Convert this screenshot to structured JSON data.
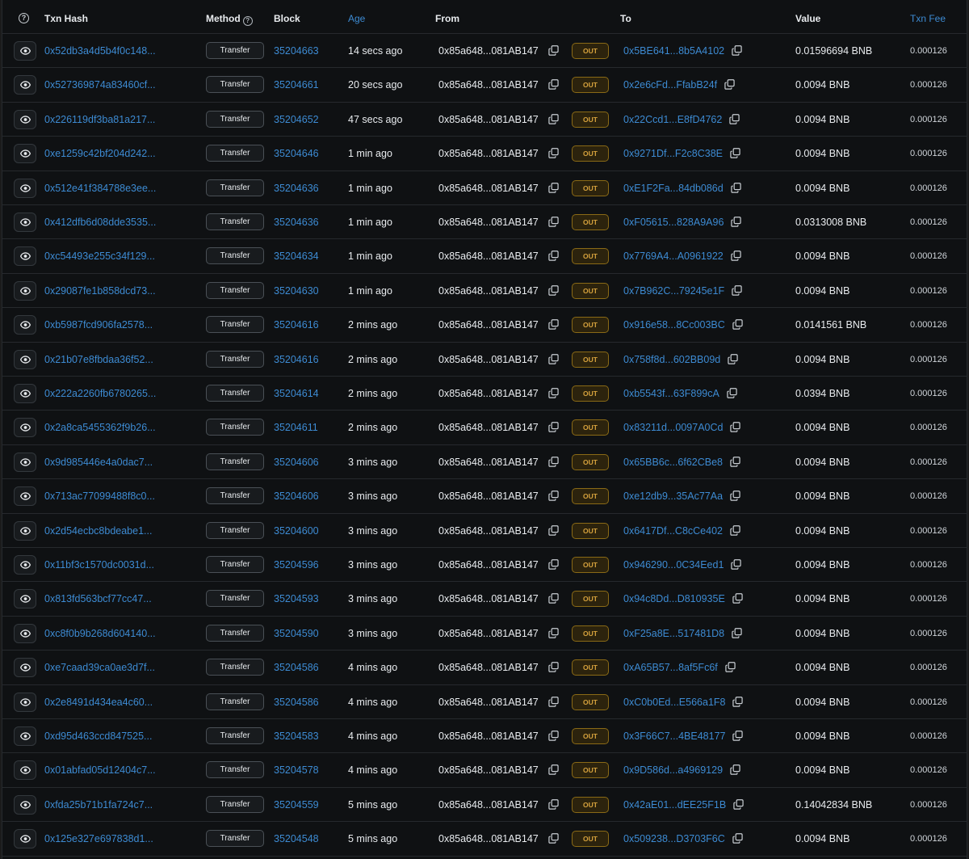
{
  "header": {
    "txn_hash": "Txn Hash",
    "method": "Method",
    "block": "Block",
    "age": "Age",
    "from": "From",
    "to": "To",
    "value": "Value",
    "txn_fee": "Txn Fee",
    "help_glyph": "?"
  },
  "method_label": "Transfer",
  "direction_label": "OUT",
  "rows": [
    {
      "hash": "0x52db3a4d5b4f0c148...",
      "block": "35204663",
      "age": "14 secs ago",
      "from": "0x85a648...081AB147",
      "to": "0x5BE641...8b5A4102",
      "value": "0.01596694 BNB",
      "fee": "0.000126"
    },
    {
      "hash": "0x527369874a83460cf...",
      "block": "35204661",
      "age": "20 secs ago",
      "from": "0x85a648...081AB147",
      "to": "0x2e6cFd...FfabB24f",
      "value": "0.0094 BNB",
      "fee": "0.000126"
    },
    {
      "hash": "0x226119df3ba81a217...",
      "block": "35204652",
      "age": "47 secs ago",
      "from": "0x85a648...081AB147",
      "to": "0x22Ccd1...E8fD4762",
      "value": "0.0094 BNB",
      "fee": "0.000126"
    },
    {
      "hash": "0xe1259c42bf204d242...",
      "block": "35204646",
      "age": "1 min ago",
      "from": "0x85a648...081AB147",
      "to": "0x9271Df...F2c8C38E",
      "value": "0.0094 BNB",
      "fee": "0.000126"
    },
    {
      "hash": "0x512e41f384788e3ee...",
      "block": "35204636",
      "age": "1 min ago",
      "from": "0x85a648...081AB147",
      "to": "0xE1F2Fa...84db086d",
      "value": "0.0094 BNB",
      "fee": "0.000126"
    },
    {
      "hash": "0x412dfb6d08dde3535...",
      "block": "35204636",
      "age": "1 min ago",
      "from": "0x85a648...081AB147",
      "to": "0xF05615...828A9A96",
      "value": "0.0313008 BNB",
      "fee": "0.000126"
    },
    {
      "hash": "0xc54493e255c34f129...",
      "block": "35204634",
      "age": "1 min ago",
      "from": "0x85a648...081AB147",
      "to": "0x7769A4...A0961922",
      "value": "0.0094 BNB",
      "fee": "0.000126"
    },
    {
      "hash": "0x29087fe1b858dcd73...",
      "block": "35204630",
      "age": "1 min ago",
      "from": "0x85a648...081AB147",
      "to": "0x7B962C...79245e1F",
      "value": "0.0094 BNB",
      "fee": "0.000126"
    },
    {
      "hash": "0xb5987fcd906fa2578...",
      "block": "35204616",
      "age": "2 mins ago",
      "from": "0x85a648...081AB147",
      "to": "0x916e58...8Cc003BC",
      "value": "0.0141561 BNB",
      "fee": "0.000126"
    },
    {
      "hash": "0x21b07e8fbdaa36f52...",
      "block": "35204616",
      "age": "2 mins ago",
      "from": "0x85a648...081AB147",
      "to": "0x758f8d...602BB09d",
      "value": "0.0094 BNB",
      "fee": "0.000126"
    },
    {
      "hash": "0x222a2260fb6780265...",
      "block": "35204614",
      "age": "2 mins ago",
      "from": "0x85a648...081AB147",
      "to": "0xb5543f...63F899cA",
      "value": "0.0394 BNB",
      "fee": "0.000126"
    },
    {
      "hash": "0x2a8ca5455362f9b26...",
      "block": "35204611",
      "age": "2 mins ago",
      "from": "0x85a648...081AB147",
      "to": "0x83211d...0097A0Cd",
      "value": "0.0094 BNB",
      "fee": "0.000126"
    },
    {
      "hash": "0x9d985446e4a0dac7...",
      "block": "35204606",
      "age": "3 mins ago",
      "from": "0x85a648...081AB147",
      "to": "0x65BB6c...6f62CBe8",
      "value": "0.0094 BNB",
      "fee": "0.000126"
    },
    {
      "hash": "0x713ac77099488f8c0...",
      "block": "35204606",
      "age": "3 mins ago",
      "from": "0x85a648...081AB147",
      "to": "0xe12db9...35Ac77Aa",
      "value": "0.0094 BNB",
      "fee": "0.000126"
    },
    {
      "hash": "0x2d54ecbc8bdeabe1...",
      "block": "35204600",
      "age": "3 mins ago",
      "from": "0x85a648...081AB147",
      "to": "0x6417Df...C8cCe402",
      "value": "0.0094 BNB",
      "fee": "0.000126"
    },
    {
      "hash": "0x11bf3c1570dc0031d...",
      "block": "35204596",
      "age": "3 mins ago",
      "from": "0x85a648...081AB147",
      "to": "0x946290...0C34Eed1",
      "value": "0.0094 BNB",
      "fee": "0.000126"
    },
    {
      "hash": "0x813fd563bcf77cc47...",
      "block": "35204593",
      "age": "3 mins ago",
      "from": "0x85a648...081AB147",
      "to": "0x94c8Dd...D810935E",
      "value": "0.0094 BNB",
      "fee": "0.000126"
    },
    {
      "hash": "0xc8f0b9b268d604140...",
      "block": "35204590",
      "age": "3 mins ago",
      "from": "0x85a648...081AB147",
      "to": "0xF25a8E...517481D8",
      "value": "0.0094 BNB",
      "fee": "0.000126"
    },
    {
      "hash": "0xe7caad39ca0ae3d7f...",
      "block": "35204586",
      "age": "4 mins ago",
      "from": "0x85a648...081AB147",
      "to": "0xA65B57...8af5Fc6f",
      "value": "0.0094 BNB",
      "fee": "0.000126"
    },
    {
      "hash": "0x2e8491d434ea4c60...",
      "block": "35204586",
      "age": "4 mins ago",
      "from": "0x85a648...081AB147",
      "to": "0xC0b0Ed...E566a1F8",
      "value": "0.0094 BNB",
      "fee": "0.000126"
    },
    {
      "hash": "0xd95d463ccd847525...",
      "block": "35204583",
      "age": "4 mins ago",
      "from": "0x85a648...081AB147",
      "to": "0x3F66C7...4BE48177",
      "value": "0.0094 BNB",
      "fee": "0.000126"
    },
    {
      "hash": "0x01abfad05d12404c7...",
      "block": "35204578",
      "age": "4 mins ago",
      "from": "0x85a648...081AB147",
      "to": "0x9D586d...a4969129",
      "value": "0.0094 BNB",
      "fee": "0.000126"
    },
    {
      "hash": "0xfda25b71b1fa724c7...",
      "block": "35204559",
      "age": "5 mins ago",
      "from": "0x85a648...081AB147",
      "to": "0x42aE01...dEE25F1B",
      "value": "0.14042834 BNB",
      "fee": "0.000126"
    },
    {
      "hash": "0x125e327e697838d1...",
      "block": "35204548",
      "age": "5 mins ago",
      "from": "0x85a648...081AB147",
      "to": "0x509238...D3703F6C",
      "value": "0.0094 BNB",
      "fee": "0.000126"
    }
  ],
  "colors": {
    "background": "#0f1113",
    "link": "#3d8bd3",
    "text": "#e9ecef",
    "out_badge_text": "#d6a23d",
    "out_badge_border": "#8a6a16"
  },
  "icons": {
    "help": "question-circle-icon",
    "preview": "eye-icon",
    "copy": "copy-icon"
  }
}
